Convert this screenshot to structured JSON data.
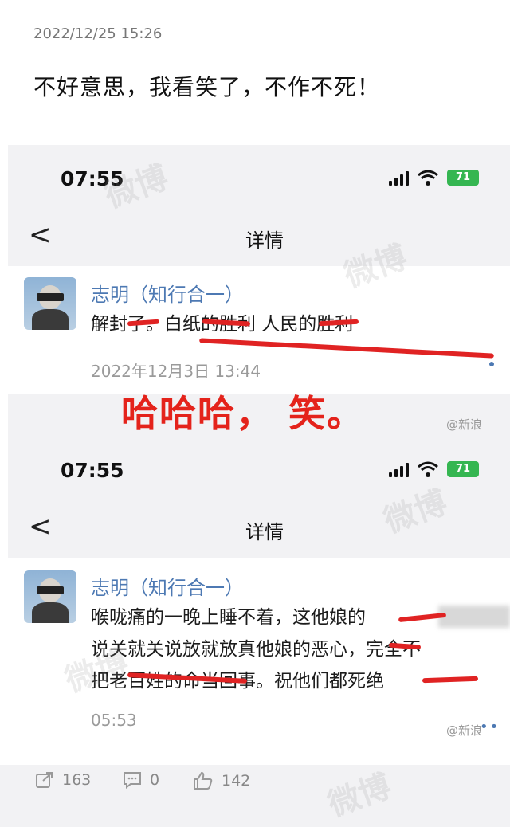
{
  "post": {
    "date": "2022/12/25 15:26",
    "text": "不好意思，我看笑了，不作不死！"
  },
  "screenshots": [
    {
      "status_time": "07:55",
      "battery": "71",
      "nav_back": "<",
      "nav_title": "详情",
      "author": "志明（知行合一）",
      "lines": [
        "解封了。白纸的胜利 人民的胜利"
      ],
      "time": "2022年12月3日 13:44"
    },
    {
      "status_time": "07:55",
      "battery": "71",
      "nav_back": "<",
      "nav_title": "详情",
      "author": "志明（知行合一）",
      "lines": [
        "喉咙痛的一晚上睡不着，这他娘的",
        "说关就关说放就放真他娘的恶心，完全不",
        "把老百姓的命当回事。祝他们都死绝"
      ],
      "time": "05:53"
    }
  ],
  "overlay_text": "哈哈哈，  笑。",
  "watermark": "@新浪",
  "ghost_watermark": "微博",
  "actions": {
    "repost_count": "163",
    "comment_count": "0",
    "like_count": "142"
  }
}
